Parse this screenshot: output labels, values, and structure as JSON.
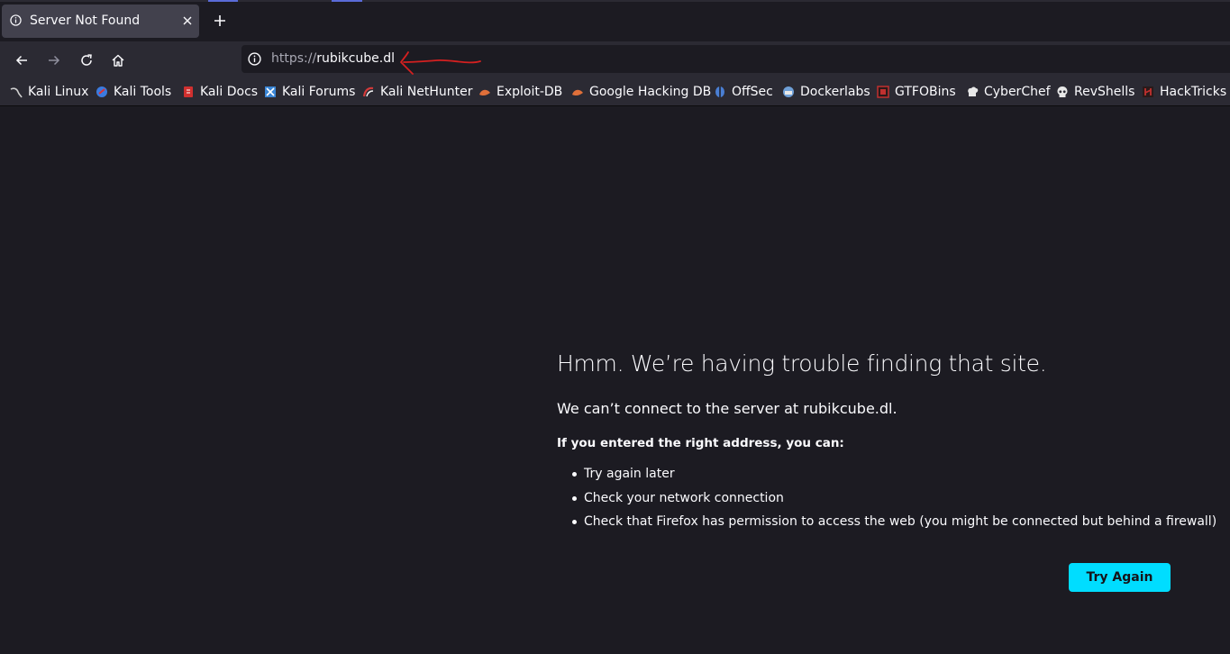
{
  "tab": {
    "title": "Server Not Found",
    "icon": "info-icon"
  },
  "nav": {
    "back_icon": "back-arrow-icon",
    "forward_icon": "forward-arrow-icon",
    "reload_icon": "reload-icon",
    "home_icon": "home-icon"
  },
  "url": {
    "scheme": "https://",
    "host": "rubikcube.dl"
  },
  "bookmarks": [
    {
      "label": "Kali Linux",
      "icon": "kali-dragon-icon",
      "color": "#cfcfcf"
    },
    {
      "label": "Kali Tools",
      "icon": "kali-tools-icon",
      "color": "#3b7be0"
    },
    {
      "label": "Kali Docs",
      "icon": "kali-docs-icon",
      "color": "#d0302f"
    },
    {
      "label": "Kali Forums",
      "icon": "kali-forums-icon",
      "color": "#3a86d6"
    },
    {
      "label": "Kali NetHunter",
      "icon": "nethunter-icon",
      "color": "#d33a3a"
    },
    {
      "label": "Exploit-DB",
      "icon": "exploit-db-icon",
      "color": "#e0703a"
    },
    {
      "label": "Google Hacking DB",
      "icon": "ghdb-icon",
      "color": "#e0703a"
    },
    {
      "label": "OffSec",
      "icon": "offsec-icon",
      "color": "#4a7fd4"
    },
    {
      "label": "Dockerlabs",
      "icon": "dockerlabs-icon",
      "color": "#6fa0d8"
    },
    {
      "label": "GTFOBins",
      "icon": "gtfobins-icon",
      "color": "#c0302f"
    },
    {
      "label": "CyberChef",
      "icon": "cyberchef-icon",
      "color": "#e8e8e8"
    },
    {
      "label": "RevShells",
      "icon": "revshells-skull-icon",
      "color": "#e8e8e8"
    },
    {
      "label": "HackTricks",
      "icon": "hacktricks-icon",
      "color": "#c0302f"
    }
  ],
  "error": {
    "title": "Hmm. We’re having trouble finding that site.",
    "description": "We can’t connect to the server at rubikcube.dl.",
    "subheading": "If you entered the right address, you can:",
    "suggestions": [
      "Try again later",
      "Check your network connection",
      "Check that Firefox has permission to access the web (you might be connected but behind a firewall)"
    ],
    "button": "Try Again"
  },
  "colors": {
    "accent": "#00ddff",
    "annotation": "#d42020",
    "page_bg": "#1c1b22",
    "toolbar_bg": "#2b2a33"
  }
}
